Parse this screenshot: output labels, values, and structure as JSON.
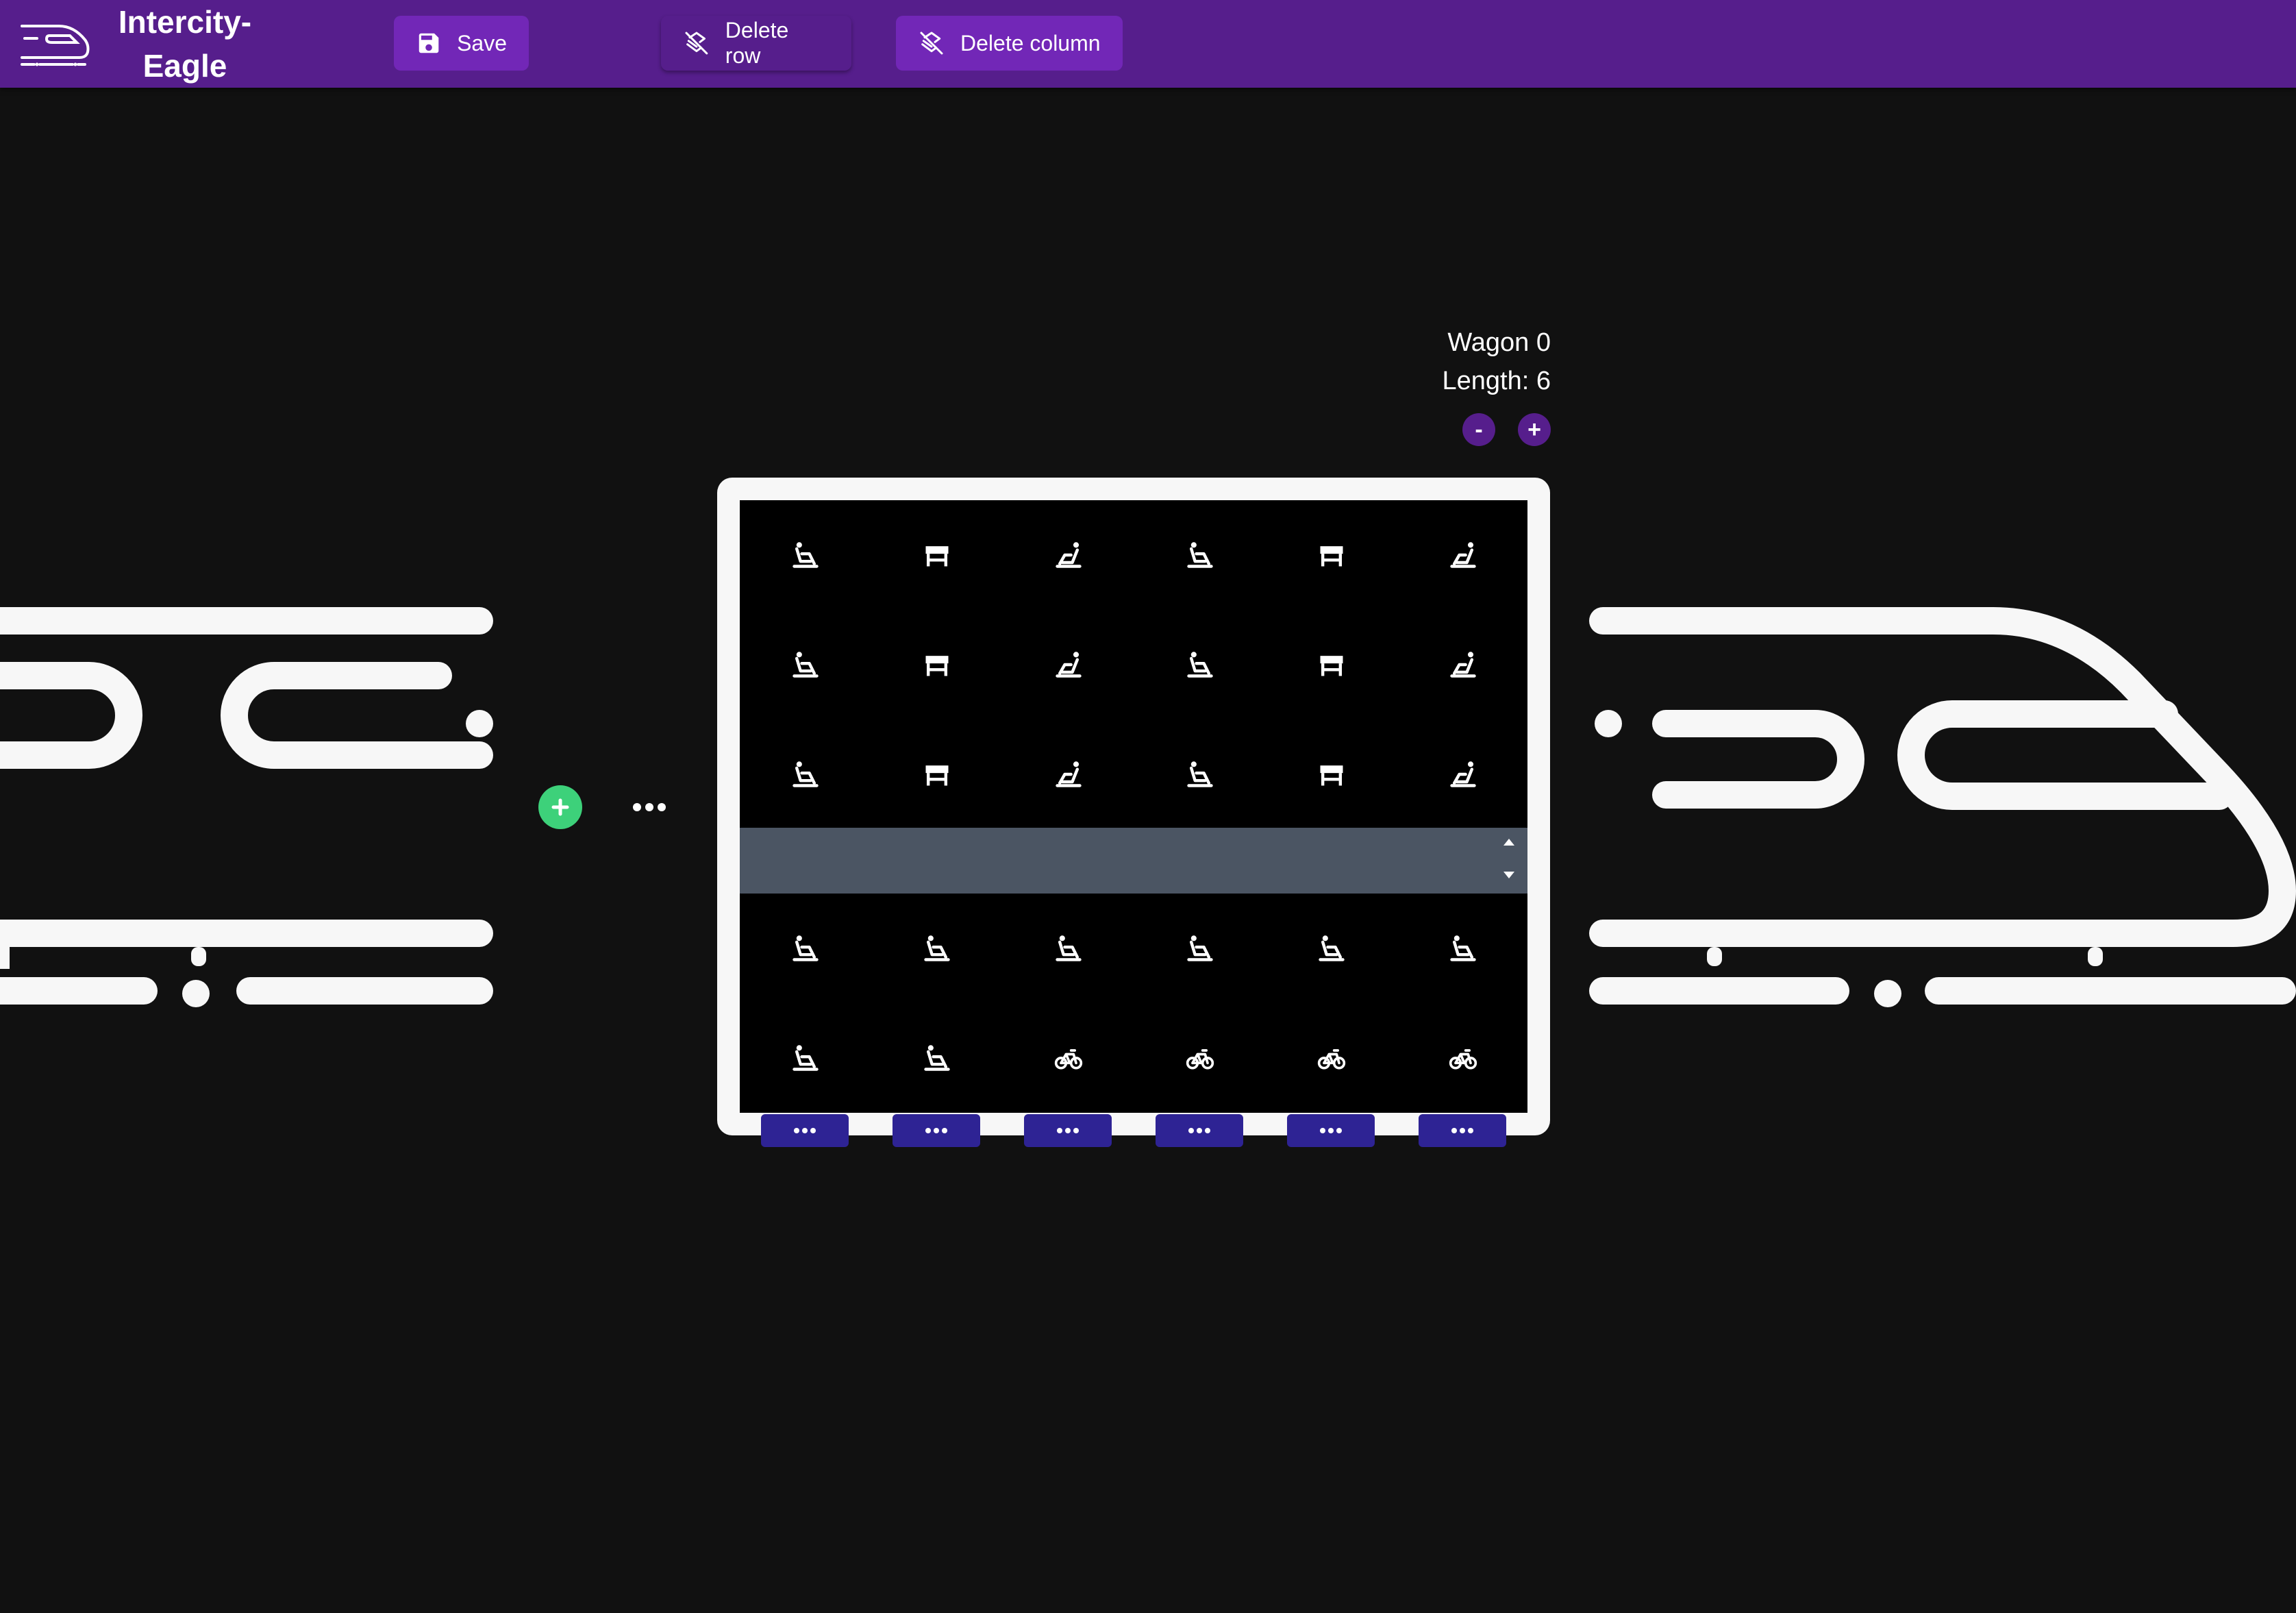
{
  "app": {
    "title": "Intercity-Eagle",
    "logo_icon": "train-icon"
  },
  "toolbar": {
    "save_label": "Save",
    "save_icon": "floppy-disk-icon",
    "delete_row_label": "Delete row",
    "delete_row_icon": "layers-off-icon",
    "delete_column_label": "Delete column",
    "delete_column_icon": "layers-off-icon"
  },
  "wagon": {
    "name": "Wagon 0",
    "length_text": "Length: 6",
    "minus_label": "-",
    "plus_label": "+",
    "rows": [
      [
        "seat-icon",
        "table-icon",
        "seat-recline-icon",
        "seat-icon",
        "table-icon",
        "seat-recline-icon"
      ],
      [
        "seat-icon",
        "table-icon",
        "seat-recline-icon",
        "seat-icon",
        "table-icon",
        "seat-recline-icon"
      ],
      [
        "seat-icon",
        "table-icon",
        "seat-recline-icon",
        "seat-icon",
        "table-icon",
        "seat-recline-icon"
      ],
      [
        "seat-icon",
        "seat-icon",
        "seat-icon",
        "seat-icon",
        "seat-icon",
        "seat-icon"
      ],
      [
        "seat-icon",
        "seat-icon",
        "bicycle-icon",
        "bicycle-icon",
        "bicycle-icon",
        "bicycle-icon"
      ]
    ],
    "aisle_after_row": 3,
    "column_menus": 6
  },
  "colors": {
    "toolbar": "#561e8c",
    "button": "#7227b7",
    "background": "#111111",
    "aisle": "#4b5563",
    "column_button": "#2e2394",
    "add_button": "#3dd17a"
  }
}
